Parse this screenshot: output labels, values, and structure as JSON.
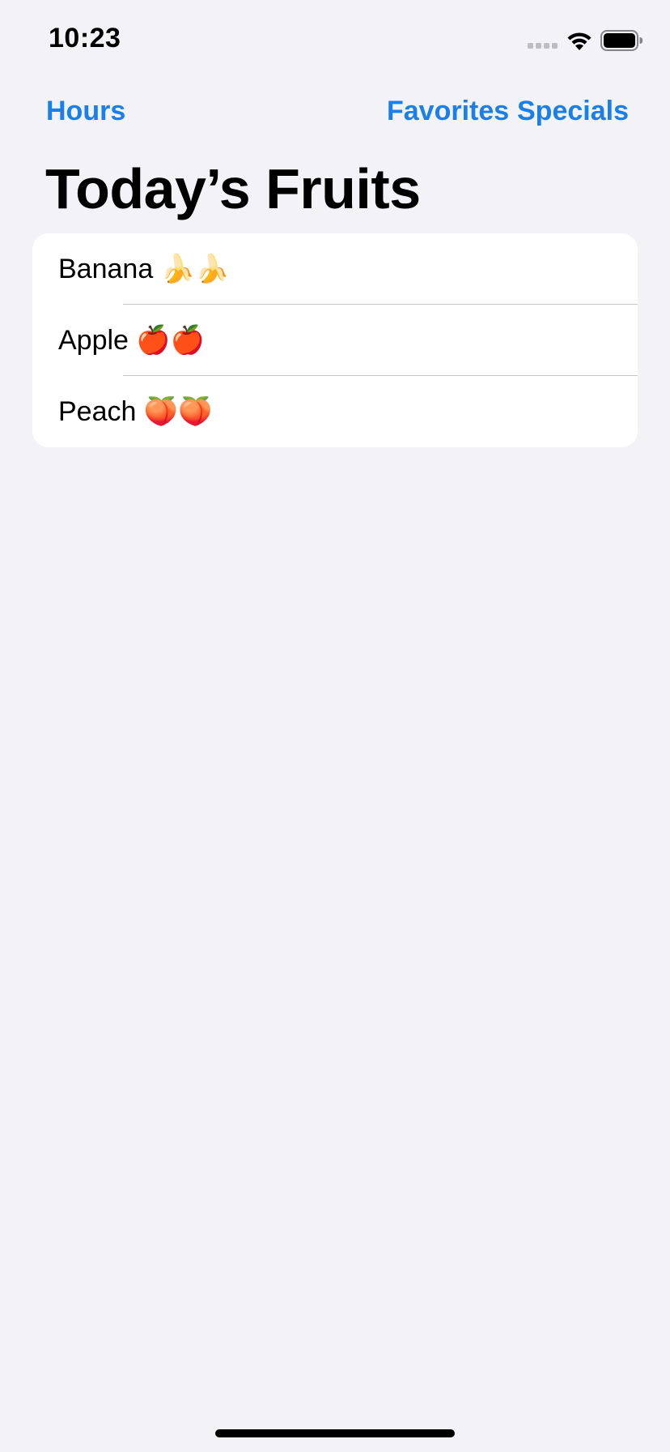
{
  "status_bar": {
    "time": "10:23",
    "signal_icon": "cellular-signal-icon",
    "wifi_icon": "wifi-icon",
    "battery_icon": "battery-icon"
  },
  "nav": {
    "left_button": "Hours",
    "right_buttons": [
      "Favorites",
      "Specials"
    ]
  },
  "title": "Today’s Fruits",
  "list": {
    "items": [
      {
        "label": "Banana 🍌🍌"
      },
      {
        "label": "Apple 🍎🍎"
      },
      {
        "label": "Peach 🍑🍑"
      }
    ]
  },
  "colors": {
    "accent": "#1A7FE8",
    "background": "#F2F2F7",
    "card": "#FFFFFF",
    "separator": "#C6C6C8"
  }
}
